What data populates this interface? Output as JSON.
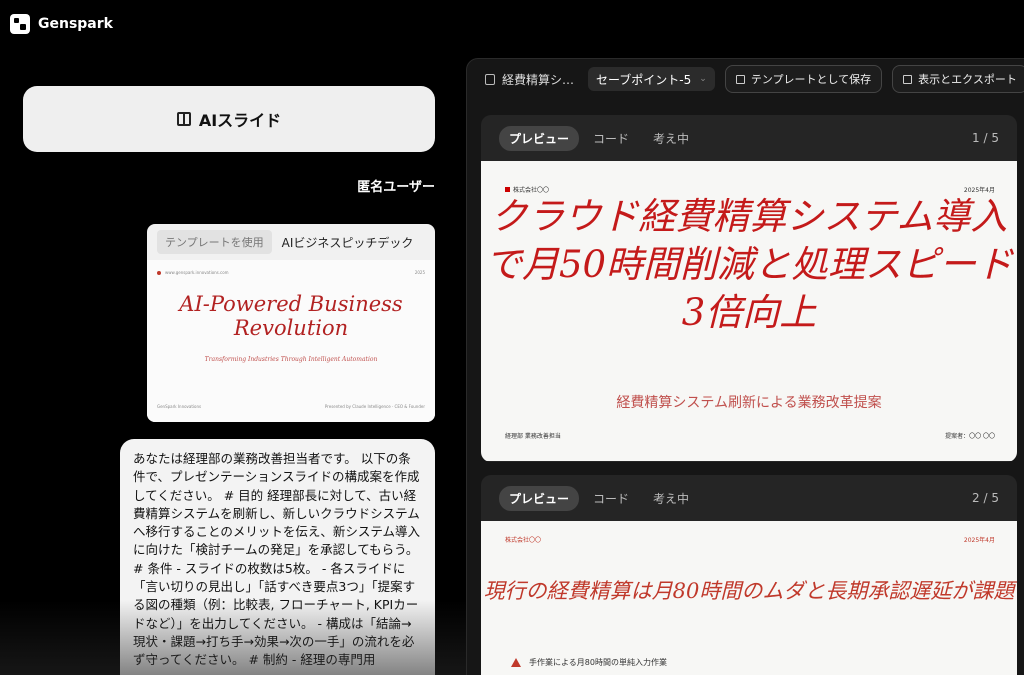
{
  "app": {
    "name": "Genspark"
  },
  "chat": {
    "ai_slides_label": "AIスライド",
    "user_name": "匿名ユーザー",
    "template_card": {
      "use_tag": "テンプレートを使用",
      "name": "AIビジネスピッチデック",
      "preview_title": "AI-Powered Business Revolution",
      "preview_subtitle": "Transforming Industries Through Intelligent Automation",
      "preview_url": "www.genspark.innovations.com",
      "preview_year": "2025",
      "preview_footer_left": "GenSpark Innovations",
      "preview_footer_right": "Presented by Claude Intelligence · CEO & Founder"
    },
    "prompt_text": "あなたは経理部の業務改善担当者です。 以下の条件で、プレゼンテーションスライドの構成案を作成してください。 # 目的 経理部長に対して、古い経費精算システムを刷新し、新しいクラウドシステムへ移行することのメリットを伝え、新システム導入に向けた「検討チームの発足」を承認してもらう。 # 条件 - スライドの枚数は5枚。 - 各スライドに「言い切りの見出し」「話すべき要点3つ」「提案する図の種類（例：比較表, フローチャート, KPIカードなど）」を出力してください。 - 構成は「結論→現状・課題→打ち手→効果→次の一手」の流れを必ず守ってください。 # 制約 - 経理の専門用"
  },
  "panel": {
    "doc_title": "経費精算シ…",
    "savepoint": "セーブポイント-5",
    "save_template_label": "テンプレートとして保存",
    "export_label": "表示とエクスポート",
    "tabs": [
      "プレビュー",
      "コード",
      "考え中"
    ],
    "slides": [
      {
        "page": "1 / 5",
        "company": "株式会社〇〇",
        "date": "2025年4月",
        "title": "クラウド経費精算システム導入で月50時間削減と処理スピード3倍向上",
        "subtitle": "経費精算システム刷新による業務改革提案",
        "footer_left": "経理部 業務改善担当",
        "footer_right": "提案者：〇〇 〇〇"
      },
      {
        "page": "2 / 5",
        "company": "株式会社〇〇",
        "date": "2025年4月",
        "title": "現行の経費精算は月80時間のムダと長期承認遅延が課題",
        "warning": "手作業による月80時間の単純入力作業"
      }
    ]
  }
}
